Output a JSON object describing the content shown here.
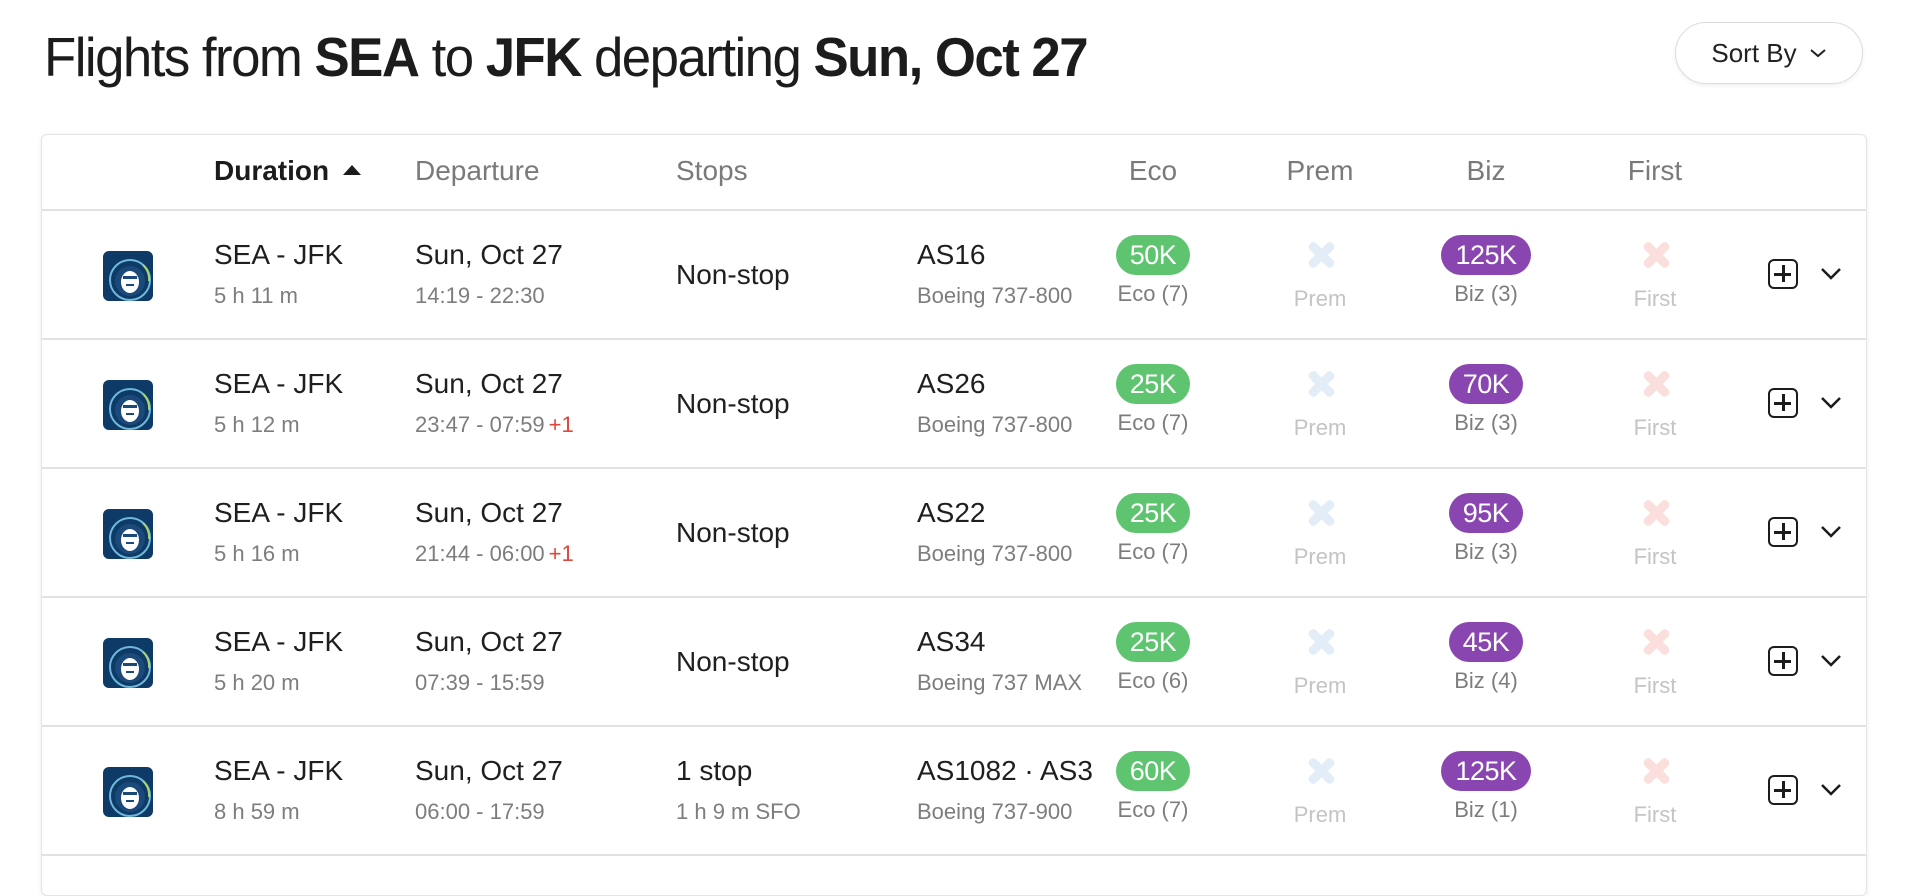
{
  "header": {
    "title_parts": [
      {
        "text": "Flights from ",
        "bold": false
      },
      {
        "text": "SEA",
        "bold": true
      },
      {
        "text": " to ",
        "bold": false
      },
      {
        "text": "JFK",
        "bold": true
      },
      {
        "text": " departing ",
        "bold": false
      },
      {
        "text": "Sun, Oct 27",
        "bold": true
      }
    ],
    "sort_button_label": "Sort By",
    "sort_button_icon": "chevron-down-icon"
  },
  "table": {
    "columns": {
      "duration": "Duration",
      "departure": "Departure",
      "stops": "Stops",
      "eco": "Eco",
      "prem": "Prem",
      "biz": "Biz",
      "first": "First"
    },
    "sorted_by": "Duration",
    "sort_direction": "ascending",
    "colors": {
      "eco_badge": "#5ec46f",
      "biz_badge": "#8a46b0",
      "prem_unavailable": "#e2edf8",
      "first_unavailable": "#fbdfdc",
      "next_day": "#e0463a",
      "airline_logo": "#0e3a68"
    },
    "rows": [
      {
        "airline_icon": "alaska-airlines-logo",
        "route": "SEA - JFK",
        "duration": "5 h 11 m",
        "date": "Sun, Oct 27",
        "times": "14:19 - 22:30",
        "next_day": "",
        "stops": "Non-stop",
        "stops_detail": "",
        "flight": "AS16",
        "aircraft": "Boeing 737-800",
        "eco": {
          "available": true,
          "price": "50K",
          "label": "Eco (7)"
        },
        "prem": {
          "available": false,
          "label": "Prem"
        },
        "biz": {
          "available": true,
          "price": "125K",
          "label": "Biz (3)"
        },
        "first": {
          "available": false,
          "label": "First"
        }
      },
      {
        "airline_icon": "alaska-airlines-logo",
        "route": "SEA - JFK",
        "duration": "5 h 12 m",
        "date": "Sun, Oct 27",
        "times": "23:47 - 07:59",
        "next_day": "+1",
        "stops": "Non-stop",
        "stops_detail": "",
        "flight": "AS26",
        "aircraft": "Boeing 737-800",
        "eco": {
          "available": true,
          "price": "25K",
          "label": "Eco (7)"
        },
        "prem": {
          "available": false,
          "label": "Prem"
        },
        "biz": {
          "available": true,
          "price": "70K",
          "label": "Biz (3)"
        },
        "first": {
          "available": false,
          "label": "First"
        }
      },
      {
        "airline_icon": "alaska-airlines-logo",
        "route": "SEA - JFK",
        "duration": "5 h 16 m",
        "date": "Sun, Oct 27",
        "times": "21:44 - 06:00",
        "next_day": "+1",
        "stops": "Non-stop",
        "stops_detail": "",
        "flight": "AS22",
        "aircraft": "Boeing 737-800",
        "eco": {
          "available": true,
          "price": "25K",
          "label": "Eco (7)"
        },
        "prem": {
          "available": false,
          "label": "Prem"
        },
        "biz": {
          "available": true,
          "price": "95K",
          "label": "Biz (3)"
        },
        "first": {
          "available": false,
          "label": "First"
        }
      },
      {
        "airline_icon": "alaska-airlines-logo",
        "route": "SEA - JFK",
        "duration": "5 h 20 m",
        "date": "Sun, Oct 27",
        "times": "07:39 - 15:59",
        "next_day": "",
        "stops": "Non-stop",
        "stops_detail": "",
        "flight": "AS34",
        "aircraft": "Boeing 737 MAX",
        "eco": {
          "available": true,
          "price": "25K",
          "label": "Eco (6)"
        },
        "prem": {
          "available": false,
          "label": "Prem"
        },
        "biz": {
          "available": true,
          "price": "45K",
          "label": "Biz (4)"
        },
        "first": {
          "available": false,
          "label": "First"
        }
      },
      {
        "airline_icon": "alaska-airlines-logo",
        "route": "SEA - JFK",
        "duration": "8 h 59 m",
        "date": "Sun, Oct 27",
        "times": "06:00 - 17:59",
        "next_day": "",
        "stops": "1 stop",
        "stops_detail": "1 h 9 m  SFO",
        "flight": "AS1082 · AS3",
        "aircraft": "Boeing 737-900",
        "eco": {
          "available": true,
          "price": "60K",
          "label": "Eco (7)"
        },
        "prem": {
          "available": false,
          "label": "Prem"
        },
        "biz": {
          "available": true,
          "price": "125K",
          "label": "Biz (1)"
        },
        "first": {
          "available": false,
          "label": "First"
        }
      }
    ]
  }
}
